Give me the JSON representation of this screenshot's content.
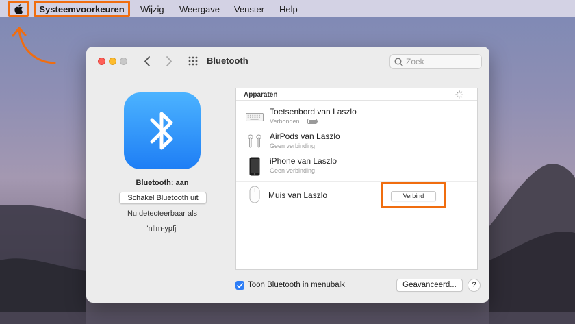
{
  "menubar": {
    "app_name": "Systeemvoorkeuren",
    "items": [
      "Wijzig",
      "Weergave",
      "Venster",
      "Help"
    ]
  },
  "window": {
    "title": "Bluetooth",
    "search_placeholder": "Zoek"
  },
  "bluetooth": {
    "status": "Bluetooth: aan",
    "toggle_label": "Schakel Bluetooth uit",
    "discoverable": "Nu detecteerbaar als",
    "device_name": "'nllm-ypfj'"
  },
  "devices": {
    "header": "Apparaten",
    "items": [
      {
        "name": "Toetsenbord van Laszlo",
        "status": "Verbonden",
        "icon": "keyboard-icon"
      },
      {
        "name": "AirPods van Laszlo",
        "status": "Geen verbinding",
        "icon": "airpods-icon"
      },
      {
        "name": "iPhone van Laszlo",
        "status": "Geen verbinding",
        "icon": "iphone-icon"
      },
      {
        "name": "Muis van Laszlo",
        "status": "",
        "icon": "mouse-icon"
      }
    ],
    "connect_label": "Verbind"
  },
  "footer": {
    "show_in_menubar": "Toon Bluetooth in menubalk",
    "show_in_menubar_checked": true,
    "advanced_label": "Geavanceerd...",
    "help_label": "?"
  },
  "colors": {
    "highlight": "#f06d0f",
    "accent": "#2d7df6",
    "bluetooth_icon": "#1e7ef5"
  }
}
